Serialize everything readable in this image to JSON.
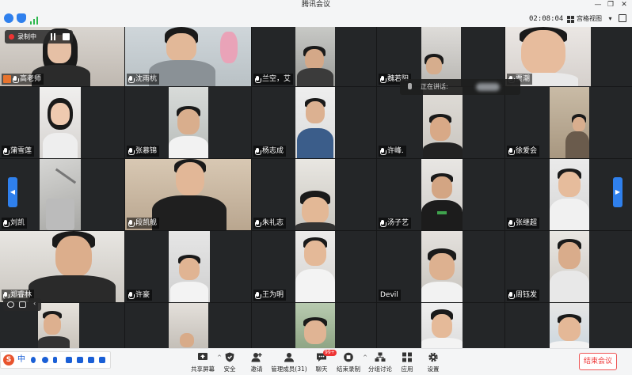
{
  "window": {
    "title": "腾讯会议",
    "controls": [
      "—",
      "❐",
      "✕"
    ]
  },
  "topbar": {
    "time": "02:08:04",
    "view_label": "宫格视图",
    "view_caret": "▾"
  },
  "recording": {
    "label": "录制中"
  },
  "speaking": {
    "label": "正在讲话:"
  },
  "participants": [
    {
      "name": "高老师",
      "host": true
    },
    {
      "name": "沈雨杭"
    },
    {
      "name": "兰空，艾"
    },
    {
      "name": "魏若阳"
    },
    {
      "name": "贾潮"
    },
    {
      "name": "蒲雪莲"
    },
    {
      "name": "张慕锦"
    },
    {
      "name": "杨志成"
    },
    {
      "name": "许峰."
    },
    {
      "name": "徐爱会"
    },
    {
      "name": "刘凯"
    },
    {
      "name": "段凯舰"
    },
    {
      "name": "朱礼志"
    },
    {
      "name": "汤子艺"
    },
    {
      "name": "张继超"
    },
    {
      "name": "郑睿林"
    },
    {
      "name": "许豪"
    },
    {
      "name": "王为明"
    },
    {
      "name": "Devil"
    },
    {
      "name": "周钰发"
    }
  ],
  "pager": {
    "prev": "◀",
    "next": "▶"
  },
  "toolbar": {
    "items": [
      {
        "label": "共享屏幕",
        "icon": "share-screen-icon"
      },
      {
        "label": "安全",
        "icon": "shield-icon"
      },
      {
        "label": "邀请",
        "icon": "invite-icon"
      },
      {
        "label": "管理成员(31)",
        "icon": "members-icon"
      },
      {
        "label": "聊天",
        "icon": "chat-icon",
        "badge": "99+"
      },
      {
        "label": "结束录制",
        "icon": "stop-record-icon"
      },
      {
        "label": "分组讨论",
        "icon": "breakout-icon"
      },
      {
        "label": "应用",
        "icon": "apps-icon"
      },
      {
        "label": "设置",
        "icon": "gear-icon"
      }
    ],
    "end_label": "结束会议"
  },
  "ime": {
    "logo": "S",
    "mode": "中"
  },
  "colors": {
    "accent": "#2f80ed",
    "danger": "#e33333",
    "grid_bg": "#161718"
  }
}
